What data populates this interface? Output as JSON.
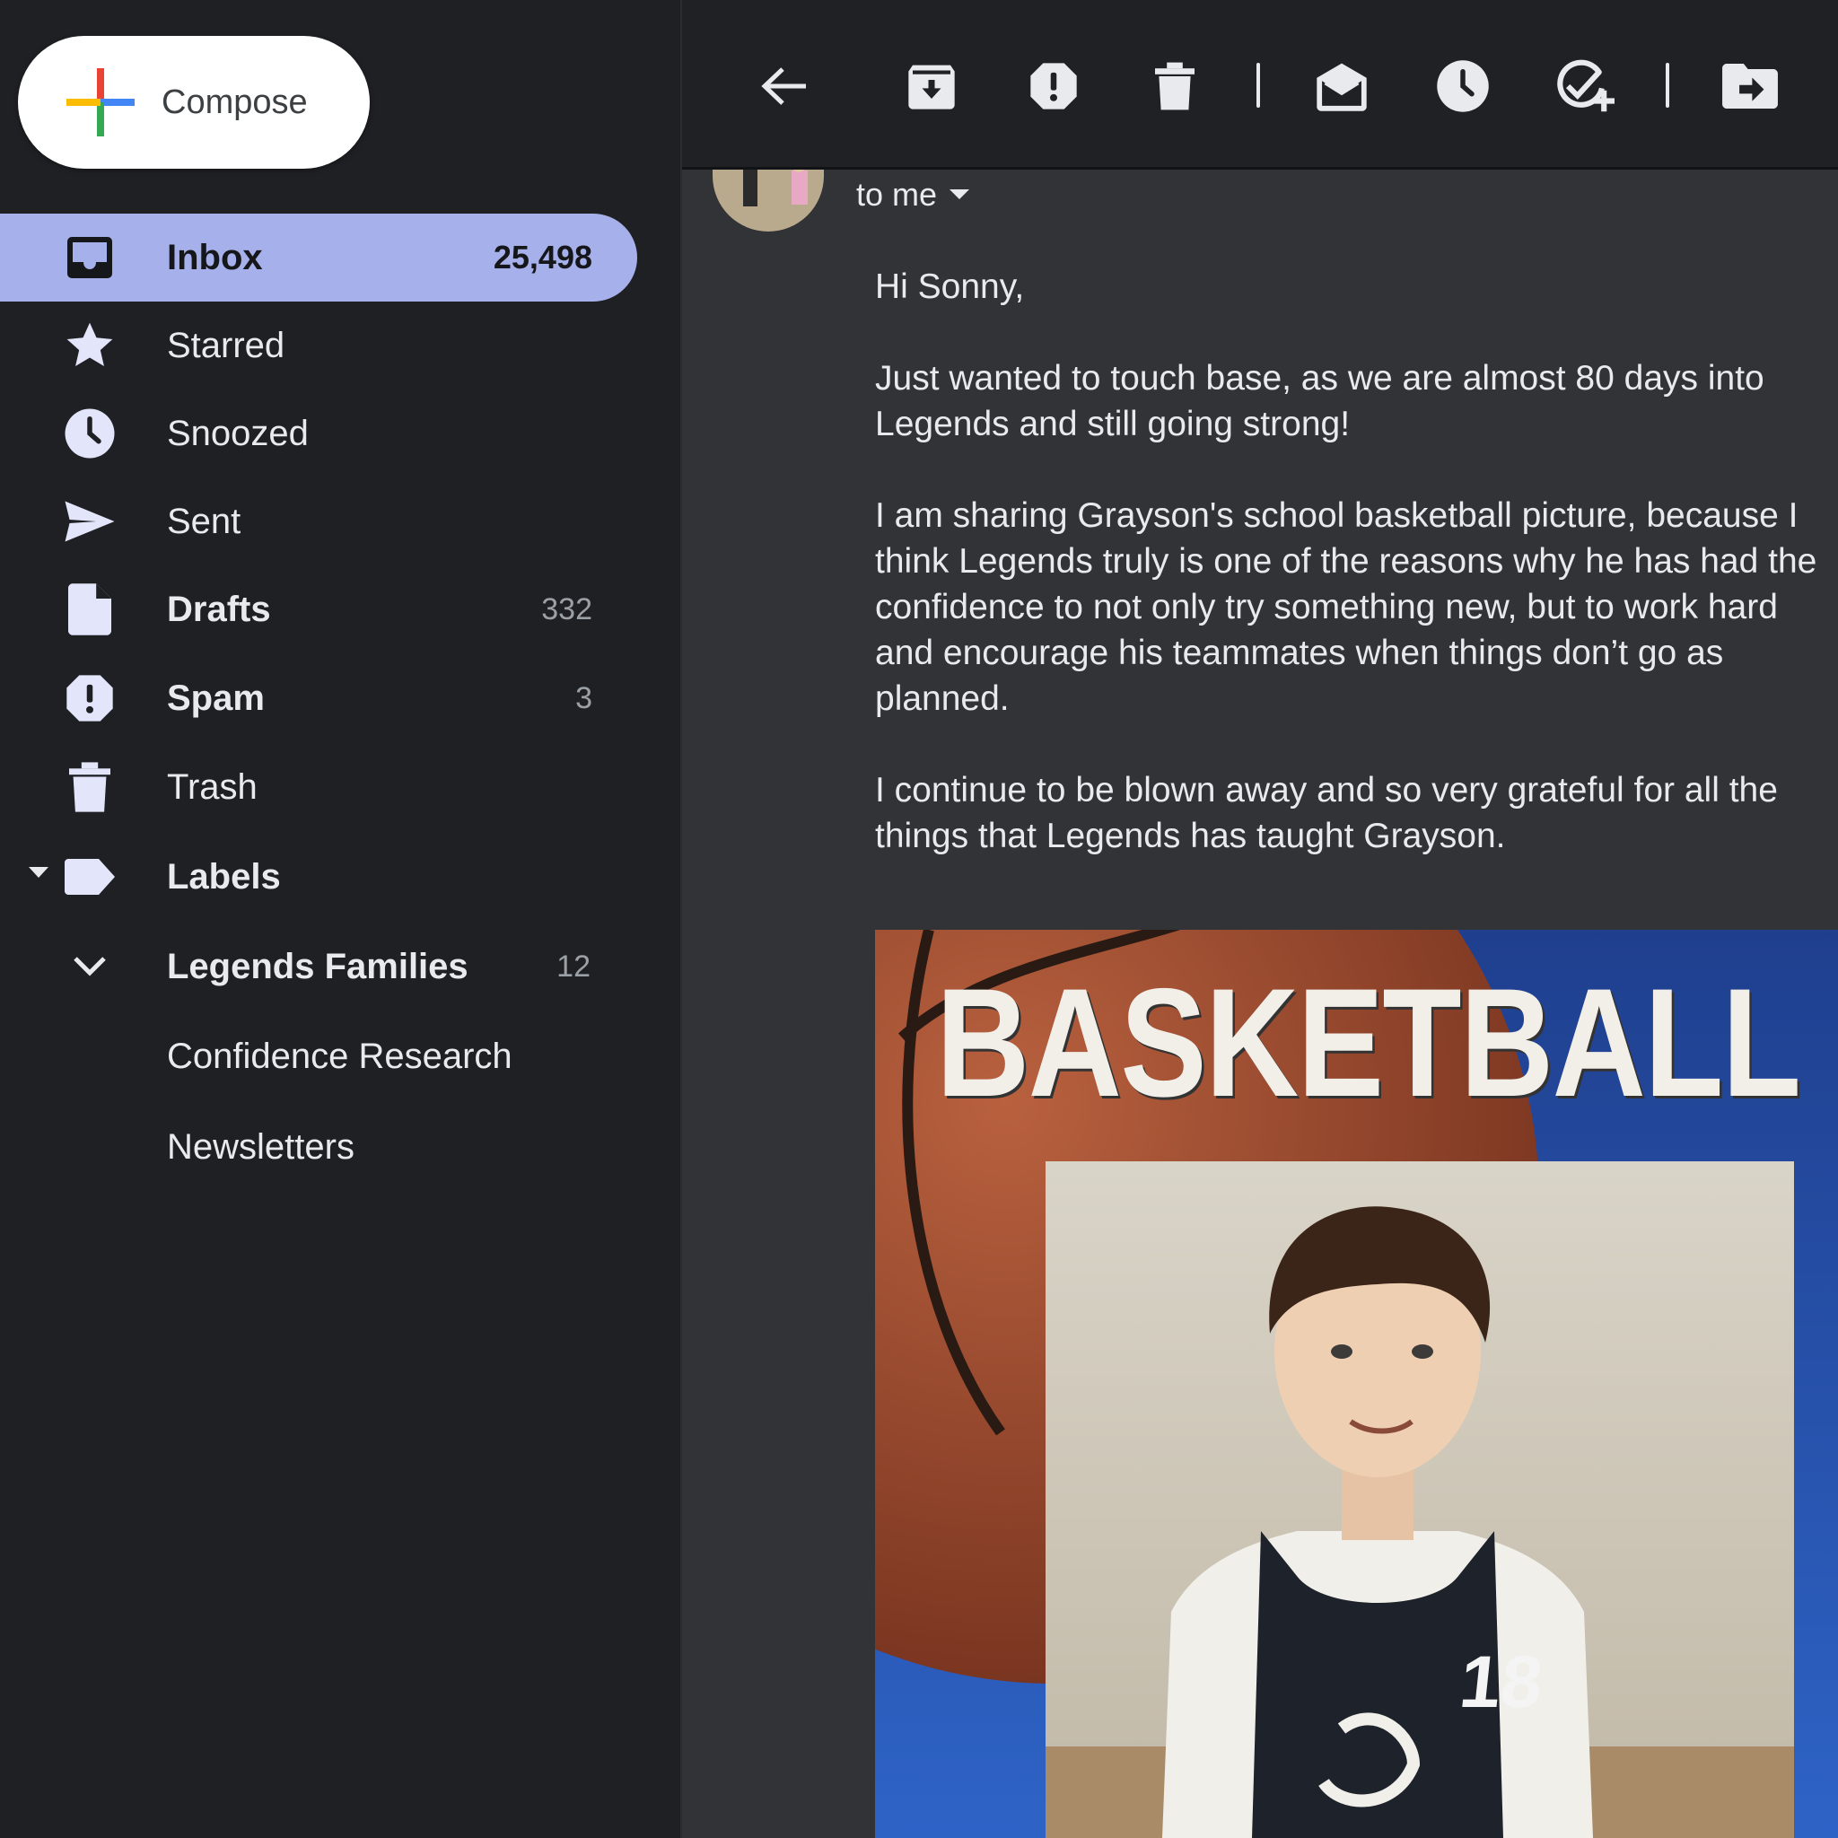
{
  "compose": {
    "label": "Compose"
  },
  "sidebar": {
    "items": [
      {
        "label": "Inbox",
        "count": "25,498",
        "icon": "inbox-icon",
        "active": true
      },
      {
        "label": "Starred",
        "count": "",
        "icon": "star-icon"
      },
      {
        "label": "Snoozed",
        "count": "",
        "icon": "clock-icon"
      },
      {
        "label": "Sent",
        "count": "",
        "icon": "send-icon"
      },
      {
        "label": "Drafts",
        "count": "332",
        "icon": "draft-icon"
      },
      {
        "label": "Spam",
        "count": "3",
        "icon": "spam-icon"
      },
      {
        "label": "Trash",
        "count": "",
        "icon": "trash-icon"
      },
      {
        "label": "Labels",
        "count": "",
        "icon": "label-icon"
      },
      {
        "label": "Legends Families",
        "count": "12",
        "icon": "chevron-down-icon"
      },
      {
        "label": "Confidence Research",
        "count": ""
      },
      {
        "label": "Newsletters",
        "count": ""
      }
    ]
  },
  "toolbar": {
    "icons": [
      "back-arrow-icon",
      "archive-icon",
      "report-spam-icon",
      "delete-icon",
      "mark-unread-icon",
      "snooze-icon",
      "add-task-icon",
      "move-to-icon"
    ]
  },
  "email": {
    "recipient": "to me",
    "greeting": "Hi Sonny,",
    "paragraphs": [
      "Just wanted to touch base, as we are almost 80 days into Legends and still going strong!",
      "I am sharing Grayson's school basketball picture, because I think Legends truly is one of the reasons why he has had the confidence to not only try something new, but to work hard and encourage his teammates when things don’t go as planned.",
      "I continue to be blown away and so very grateful for all the things that Legends has taught Grayson."
    ],
    "photo": {
      "title": "BASKETBALL",
      "jersey_number": "18"
    }
  },
  "colors": {
    "active_nav": "#a6b0ea",
    "sidebar_bg": "#1f2024",
    "main_bg": "#323336",
    "icon": "#e3e6fb"
  }
}
